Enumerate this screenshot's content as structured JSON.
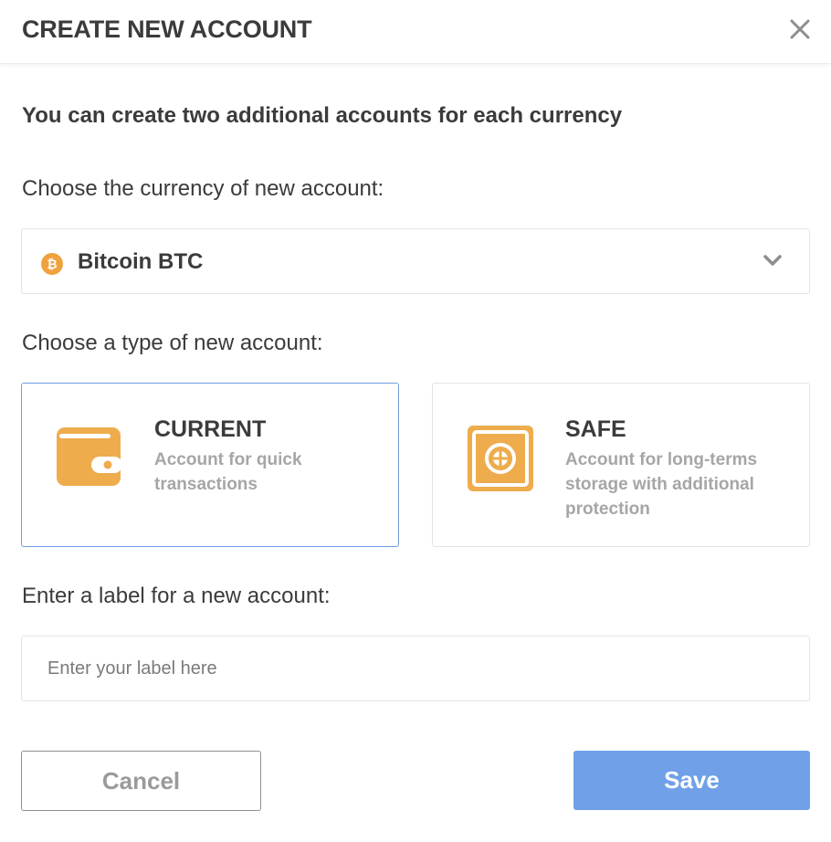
{
  "dialog": {
    "title": "CREATE NEW ACCOUNT",
    "close_icon": "close-icon"
  },
  "info_text": "You can create two additional accounts for each currency",
  "currency": {
    "label": "Choose the currency of new account:",
    "selected_value": "Bitcoin BTC",
    "icon": "bitcoin-icon",
    "icon_glyph": "₿",
    "icon_color": "#f0a23d"
  },
  "account_type": {
    "label": "Choose a type of new account:",
    "selected": "CURRENT",
    "options": [
      {
        "name": "CURRENT",
        "description": "Account for quick transactions",
        "icon": "wallet-icon"
      },
      {
        "name": "SAFE",
        "description": "Account for long-terms storage with additional protection",
        "icon": "safe-icon"
      }
    ]
  },
  "account_label": {
    "label": "Enter a label for a new account:",
    "placeholder": "Enter your label here",
    "value": ""
  },
  "actions": {
    "cancel_label": "Cancel",
    "save_label": "Save"
  },
  "colors": {
    "accent": "#6fa0e8",
    "icon_orange": "#eeac4d",
    "selected_border": "#6f9ce0",
    "muted_text": "#a6a6a6"
  }
}
